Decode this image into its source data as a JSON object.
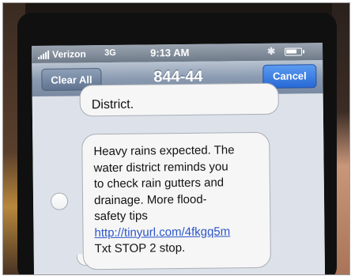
{
  "status_bar": {
    "carrier": "Verizon",
    "network": "3G",
    "time": "9:13 AM",
    "signal_bars": 5,
    "battery_level": 0.8
  },
  "nav_bar": {
    "clear_label": "Clear All",
    "title": "844-44",
    "cancel_label": "Cancel"
  },
  "messages": {
    "previous_tail": "District.",
    "current": {
      "lines": [
        "Heavy rains expected. The",
        "water district reminds you",
        "to check rain gutters and",
        "drainage.  More flood-",
        "safety tips"
      ],
      "link": "http://tinyurl.com/4fkgq5m",
      "footer": "Txt STOP 2 stop."
    }
  },
  "icons": {
    "signal": "signal-bars-icon",
    "bluetooth": "bluetooth-icon",
    "battery": "battery-icon",
    "select": "select-circle-icon"
  },
  "colors": {
    "nav_bar": "#8a9ab0",
    "cancel_button": "#2769d6",
    "link": "#2b55c9",
    "bubble": "#f6f6f6",
    "screen": "#dde2ea"
  }
}
